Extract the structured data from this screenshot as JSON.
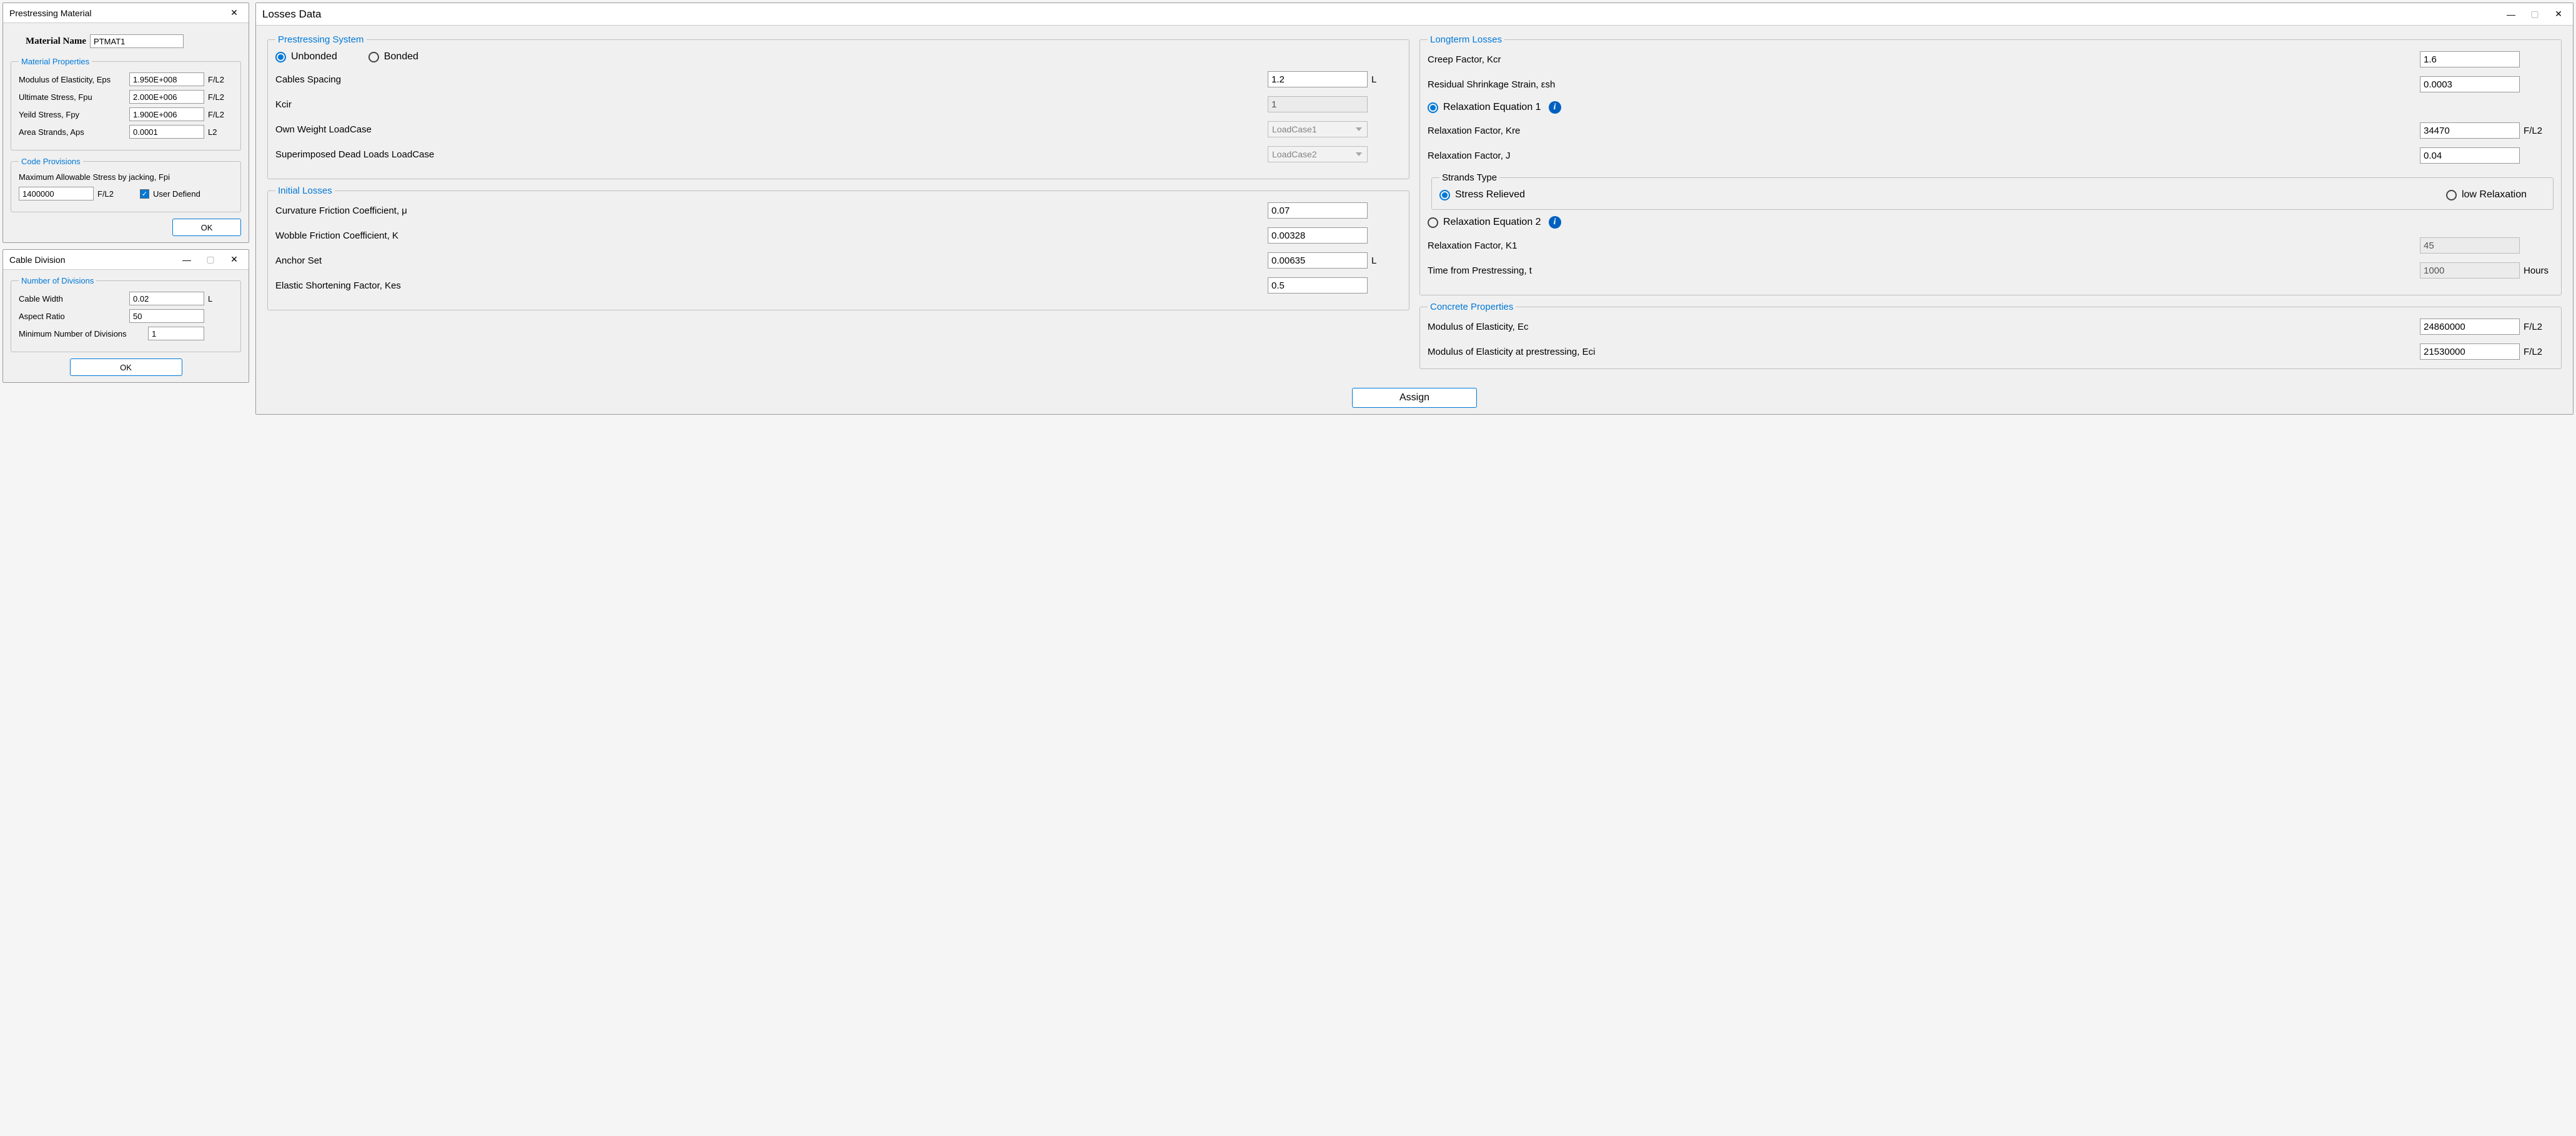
{
  "prestressing_material": {
    "title": "Prestressing Material",
    "material_name_label": "Material Name",
    "material_name_value": "PTMAT1",
    "props_legend": "Material Properties",
    "props": {
      "eps_label": "Modulus of Elasticity, Eps",
      "eps_value": "1.950E+008",
      "eps_unit": "F/L2",
      "fpu_label": "Ultimate Stress, Fpu",
      "fpu_value": "2.000E+006",
      "fpu_unit": "F/L2",
      "fpy_label": "Yeild Stress, Fpy",
      "fpy_value": "1.900E+006",
      "fpy_unit": "F/L2",
      "aps_label": "Area Strands, Aps",
      "aps_value": "0.0001",
      "aps_unit": "L2"
    },
    "code_legend": "Code Provisions",
    "code": {
      "fpi_label": "Maximum Allowable Stress by jacking, Fpi",
      "fpi_value": "1400000",
      "fpi_unit": "F/L2",
      "user_defined_label": "User Defiend",
      "user_defined_checked": true
    },
    "ok": "OK"
  },
  "cable_division": {
    "title": "Cable Division",
    "legend": "Number of Divisions",
    "width_label": "Cable Width",
    "width_value": "0.02",
    "width_unit": "L",
    "aspect_label": "Aspect Ratio",
    "aspect_value": "50",
    "mindiv_label": "Minimum Number of Divisions",
    "mindiv_value": "1",
    "ok": "OK"
  },
  "losses": {
    "title": "Losses Data",
    "system": {
      "legend": "Prestressing System",
      "unbonded": "Unbonded",
      "bonded": "Bonded",
      "spacing_label": "Cables Spacing",
      "spacing_value": "1.2",
      "spacing_unit": "L",
      "kcir_label": "Kcir",
      "kcir_value": "1",
      "own_label": "Own Weight LoadCase",
      "own_value": "LoadCase1",
      "super_label": "Superimposed Dead Loads LoadCase",
      "super_value": "LoadCase2"
    },
    "initial": {
      "legend": "Initial Losses",
      "mu_label": "Curvature Friction Coefficient, μ",
      "mu_value": "0.07",
      "k_label": "Wobble Friction Coefficient, K",
      "k_value": "0.00328",
      "anchor_label": "Anchor Set",
      "anchor_value": "0.00635",
      "anchor_unit": "L",
      "kes_label": "Elastic Shortening Factor, Kes",
      "kes_value": "0.5"
    },
    "longterm": {
      "legend": "Longterm Losses",
      "kcr_label": "Creep Factor, Kcr",
      "kcr_value": "1.6",
      "esh_label": "Residual Shrinkage Strain, εsh",
      "esh_value": "0.0003",
      "releq1_label": "Relaxation Equation 1",
      "kre_label": "Relaxation Factor, Kre",
      "kre_value": "34470",
      "kre_unit": "F/L2",
      "j_label": "Relaxation Factor, J",
      "j_value": "0.04",
      "strands_legend": "Strands Type",
      "stress_relieved_label": "Stress Relieved",
      "low_relax_label": "low Relaxation",
      "releq2_label": "Relaxation Equation 2",
      "k1_label": "Relaxation Factor, K1",
      "k1_value": "45",
      "t_label": "Time from Prestressing, t",
      "t_value": "1000",
      "t_unit": "Hours"
    },
    "concrete": {
      "legend": "Concrete Properties",
      "ec_label": "Modulus of Elasticity, Ec",
      "ec_value": "24860000",
      "ec_unit": "F/L2",
      "eci_label": "Modulus of Elasticity at prestressing, Eci",
      "eci_value": "21530000",
      "eci_unit": "F/L2"
    },
    "assign": "Assign"
  }
}
